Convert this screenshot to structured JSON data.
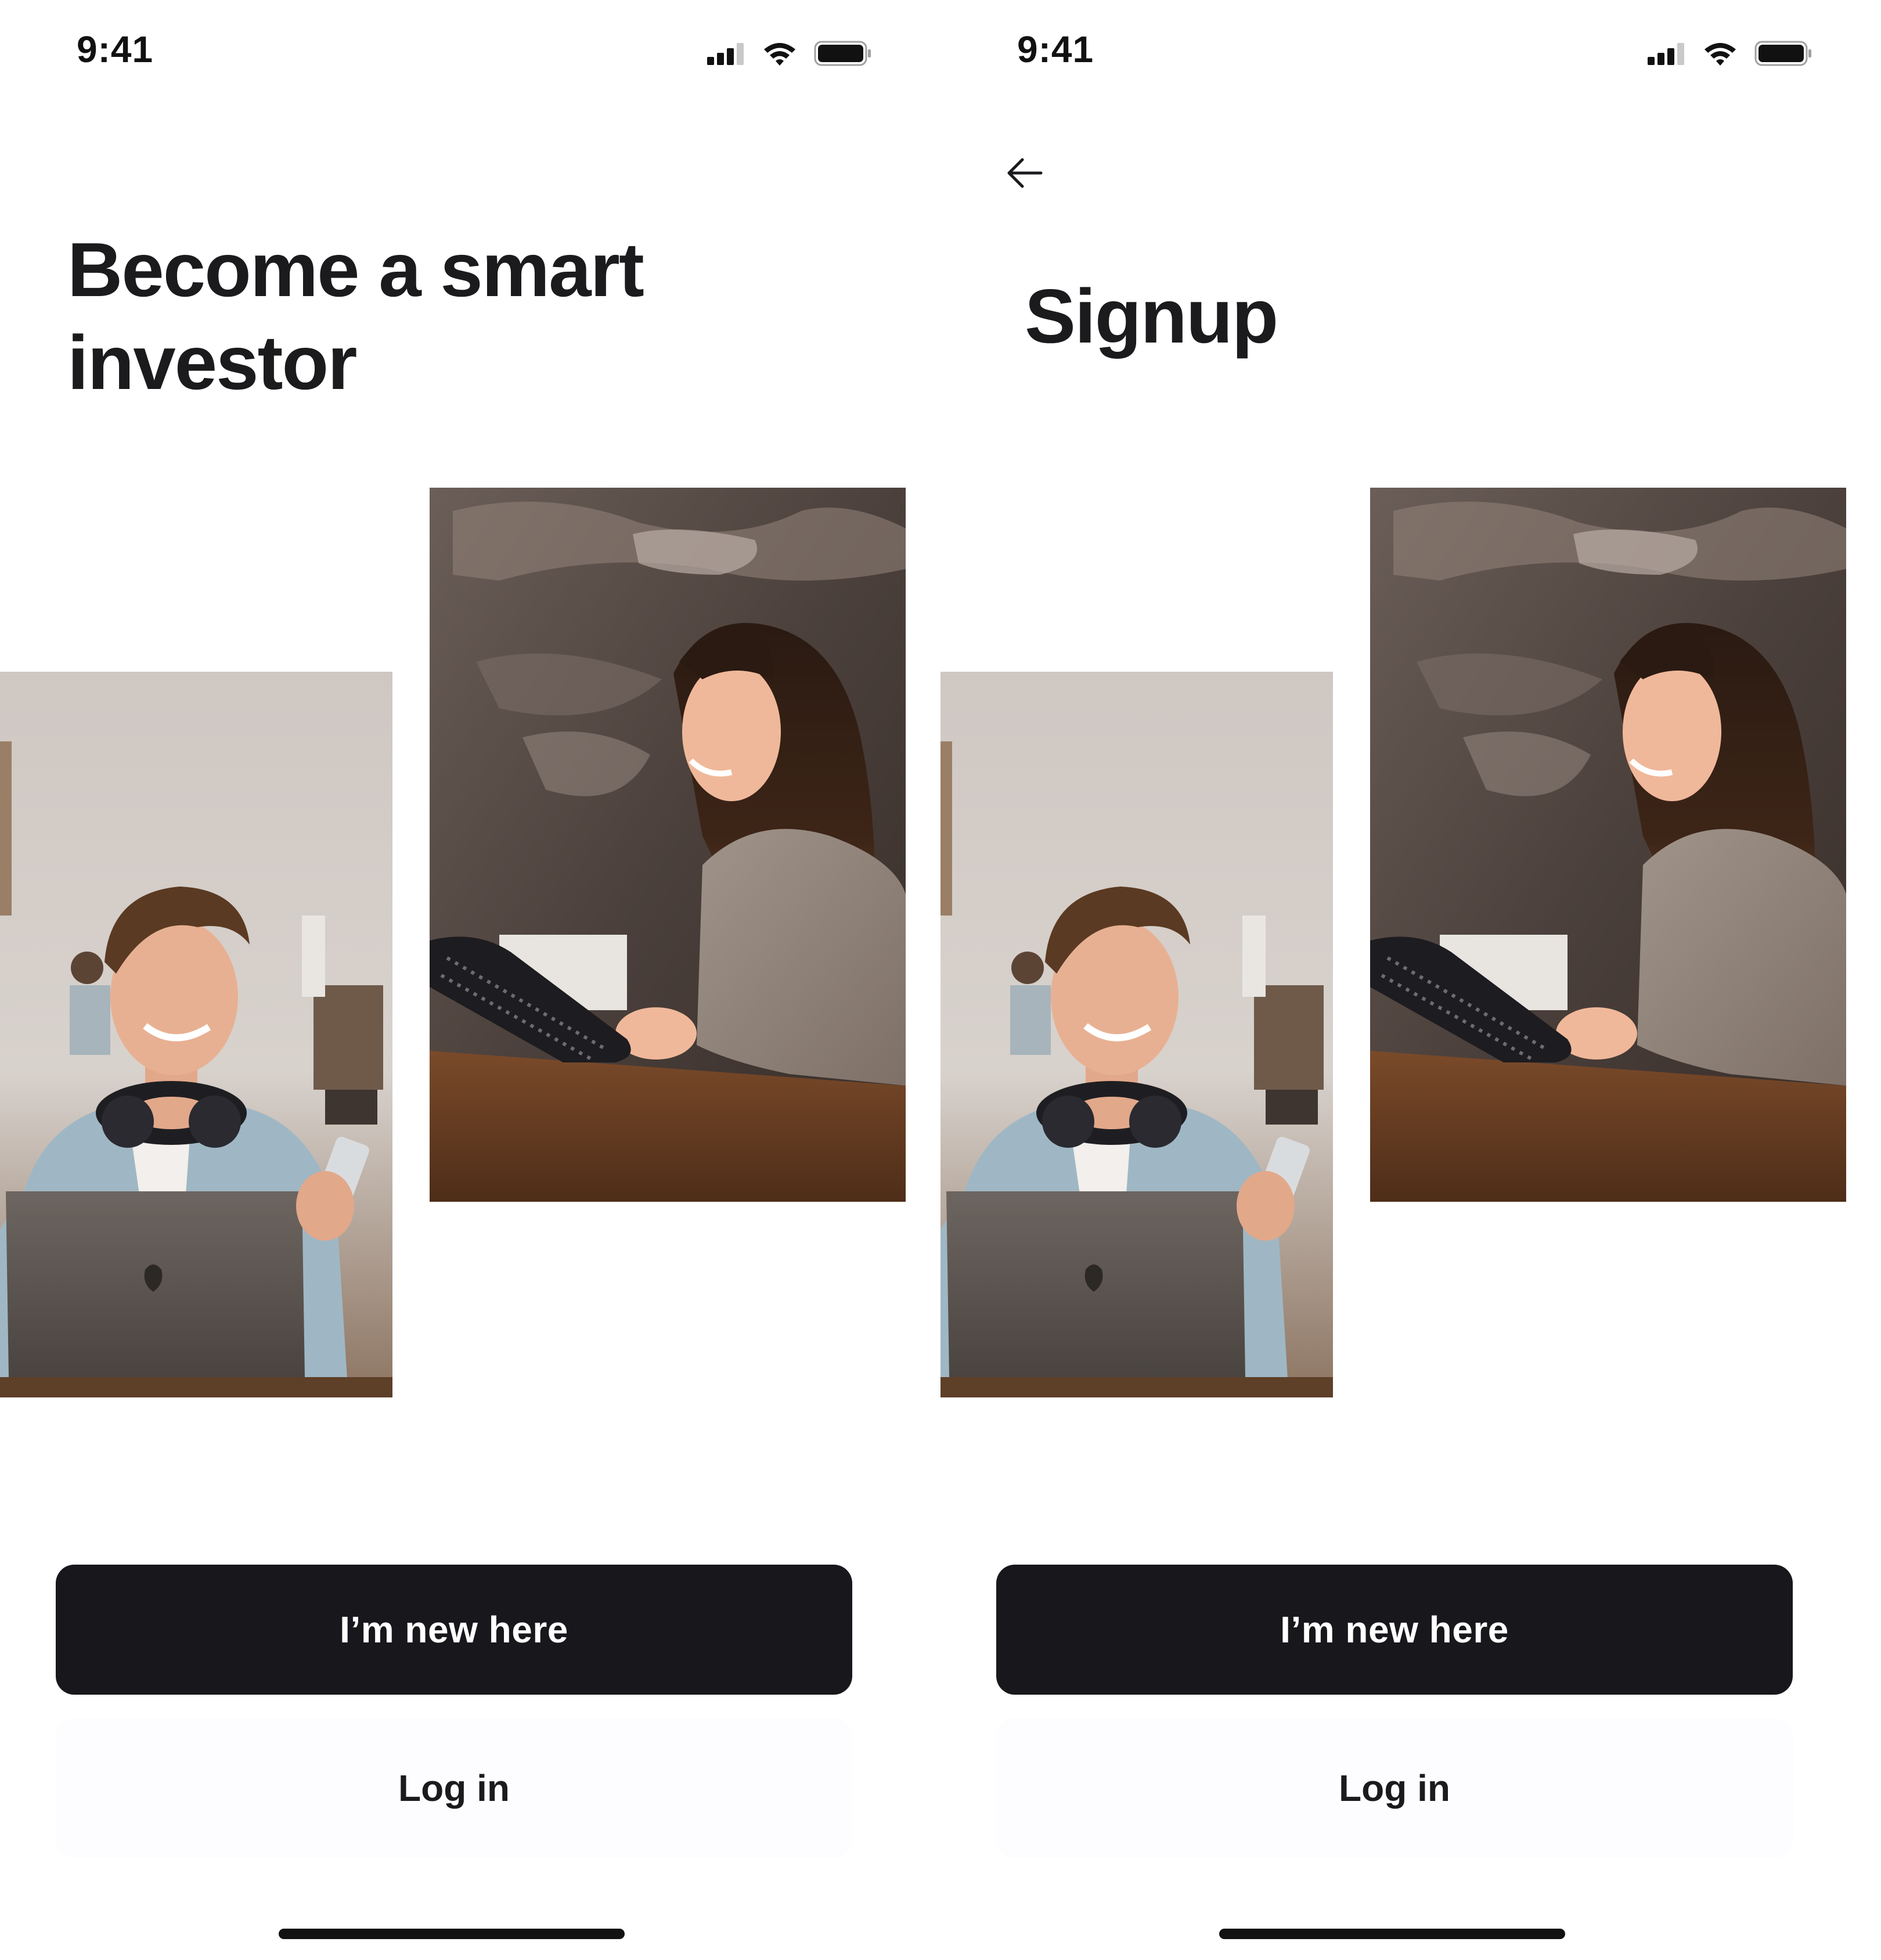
{
  "screens": [
    {
      "status_bar": {
        "time": "9:41",
        "icons": [
          "cellular-signal-icon",
          "wifi-icon",
          "battery-icon"
        ]
      },
      "title": "Become a smart investor",
      "photos": [
        {
          "name": "man-with-laptop-photo",
          "subject": "man with headphones, laptop and phone"
        },
        {
          "name": "woman-with-tablet-photo",
          "subject": "smiling woman holding tablet at table"
        }
      ],
      "primary_button": "I’m new here",
      "secondary_button": "Log in"
    },
    {
      "status_bar": {
        "time": "9:41",
        "icons": [
          "cellular-signal-icon",
          "wifi-icon",
          "battery-icon"
        ]
      },
      "back_icon": "arrow-left-icon",
      "title": "Signup",
      "photos": [
        {
          "name": "man-with-laptop-photo",
          "subject": "man with headphones, laptop and phone"
        },
        {
          "name": "woman-with-tablet-photo",
          "subject": "smiling woman holding tablet at table"
        }
      ],
      "primary_button": "I’m new here",
      "secondary_button": "Log in"
    }
  ],
  "colors": {
    "primary_button_bg": "#18171b",
    "primary_button_text": "#ffffff",
    "text": "#1b1a1d",
    "background": "#ffffff"
  }
}
